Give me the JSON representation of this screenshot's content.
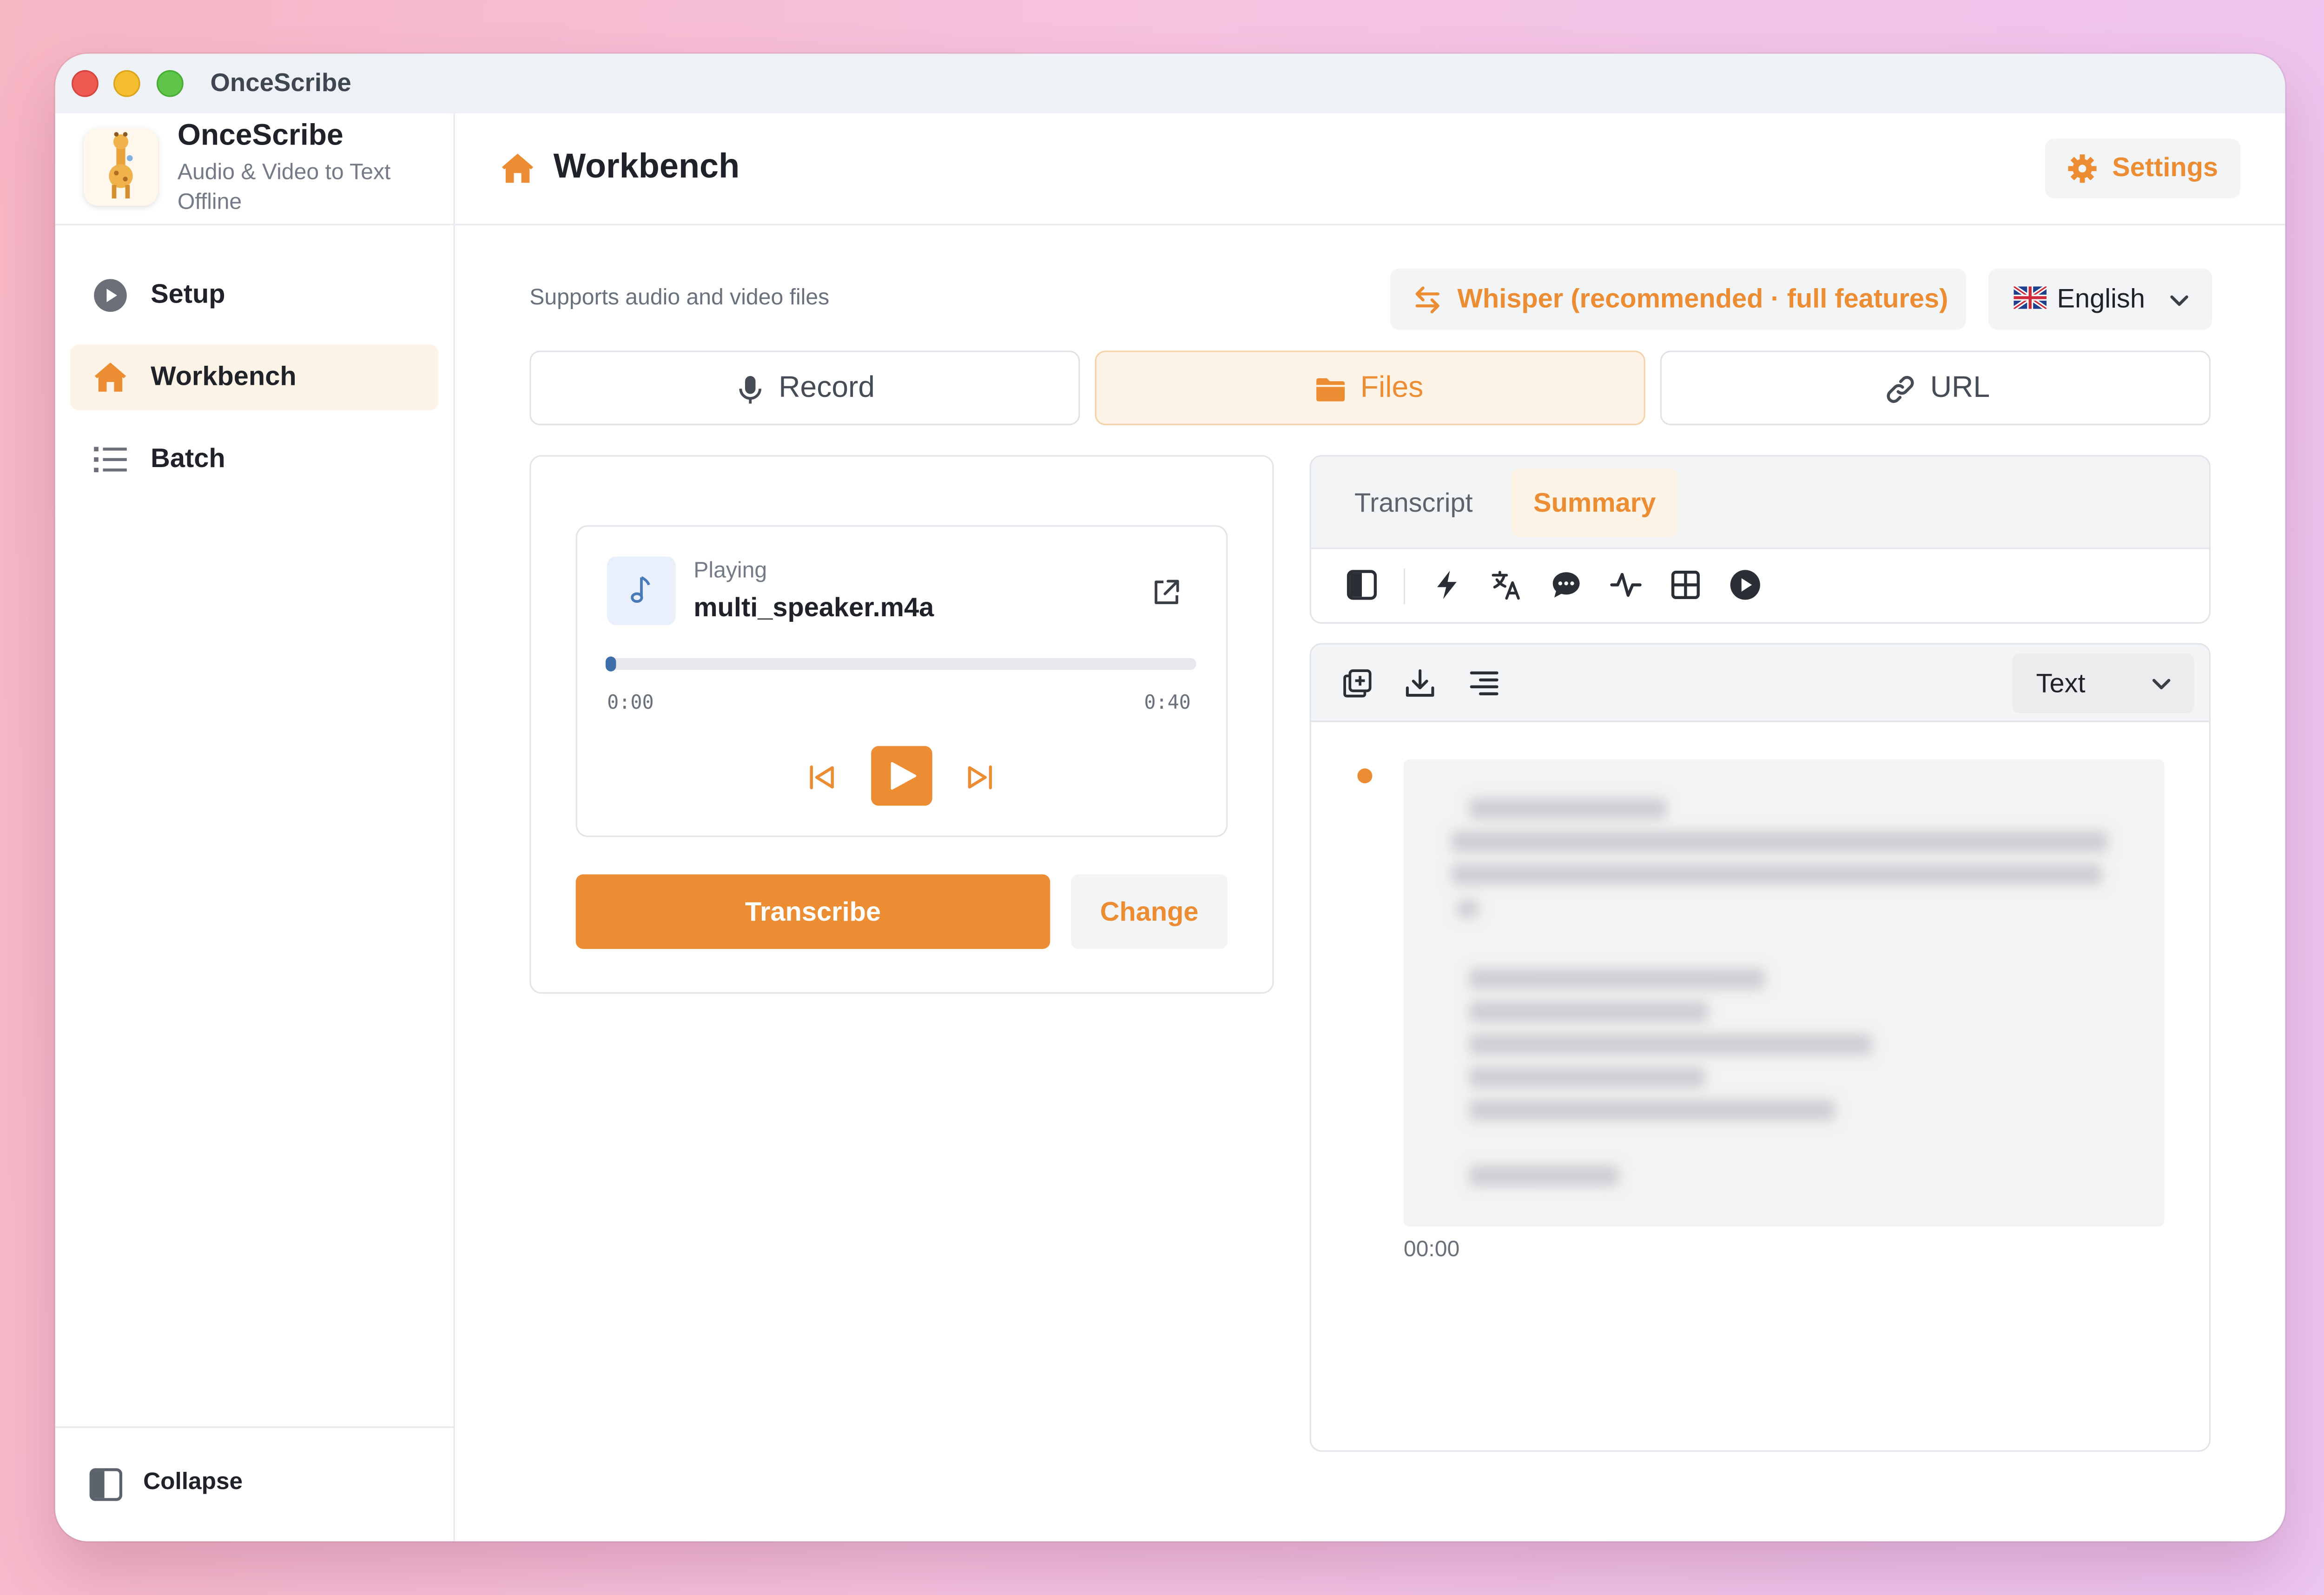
{
  "window": {
    "title": "OnceScribe"
  },
  "brand": {
    "name": "OnceScribe",
    "tagline": "Audio & Video to Text Offline"
  },
  "sidebar": {
    "items": [
      {
        "label": "Setup",
        "icon": "play-circle-icon",
        "active": false
      },
      {
        "label": "Workbench",
        "icon": "home-icon",
        "active": true
      },
      {
        "label": "Batch",
        "icon": "list-icon",
        "active": false
      }
    ],
    "collapse_label": "Collapse"
  },
  "header": {
    "title": "Workbench",
    "settings_label": "Settings"
  },
  "main": {
    "supports_text": "Supports audio and video files",
    "engine_label": "Whisper (recommended · full features)",
    "language": {
      "flag": "uk-flag-icon",
      "label": "English"
    },
    "mode_tabs": [
      {
        "label": "Record",
        "icon": "microphone-icon",
        "active": false
      },
      {
        "label": "Files",
        "icon": "folder-icon",
        "active": true
      },
      {
        "label": "URL",
        "icon": "link-icon",
        "active": false
      }
    ]
  },
  "player": {
    "status": "Playing",
    "file_name": "multi_speaker.m4a",
    "current_time": "0:00",
    "total_time": "0:40",
    "progress": 0.01,
    "transcribe_label": "Transcribe",
    "change_label": "Change"
  },
  "result": {
    "tabs": [
      {
        "label": "Transcript",
        "active": false
      },
      {
        "label": "Summary",
        "active": true
      }
    ],
    "tool_icons": [
      "sidebar-toggle-icon",
      "lightning-icon",
      "translate-icon",
      "chat-bubble-icon",
      "waveform-icon",
      "grid-icon",
      "play-circle-icon"
    ],
    "output_icons": [
      "copy-icon",
      "download-icon",
      "align-right-icon"
    ],
    "format_label": "Text",
    "segment_time": "00:00"
  },
  "colors": {
    "accent": "#ec8d33",
    "accent_soft": "#fdf3e6",
    "text": "#1f2329",
    "muted": "#747b86",
    "progress": "#4879b8"
  }
}
